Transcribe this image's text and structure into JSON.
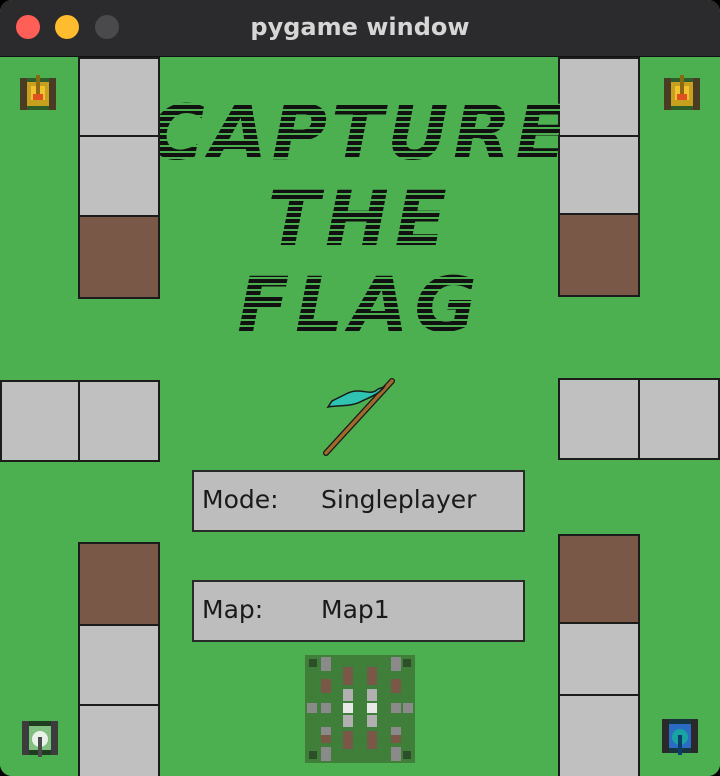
{
  "window": {
    "title": "pygame window",
    "controls": [
      "close",
      "minimize",
      "maximize"
    ]
  },
  "game": {
    "title_lines": [
      "CAPTURE",
      "THE",
      "FLAG"
    ],
    "mode_label": "Mode:",
    "mode_value": "Singleplayer",
    "map_label": "Map:",
    "map_value": "Map1"
  },
  "colors": {
    "grass": "#4caf50",
    "concrete": "#c0c0c0",
    "dirt": "#7a5848",
    "flag": "#2fc4b2",
    "tank_top": "#f2c230",
    "tank_bottom_left": "#e8f2e8",
    "tank_bottom_right": "#2a6cc4"
  },
  "icons": {
    "flag": "flag-icon",
    "tanks": [
      "yellow-tank-icon",
      "yellow-tank-icon",
      "white-tank-icon",
      "blue-tank-icon"
    ],
    "map_preview": "map-preview-thumbnail"
  }
}
